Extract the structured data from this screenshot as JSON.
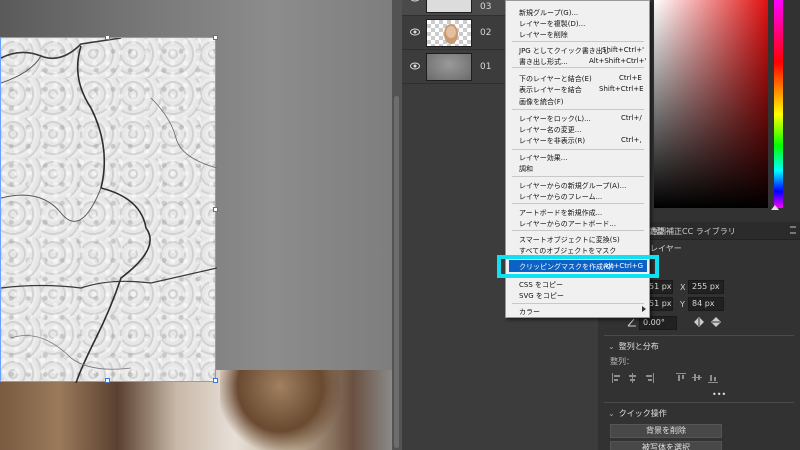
{
  "layers": [
    {
      "number": "03"
    },
    {
      "number": "02"
    },
    {
      "number": "01"
    }
  ],
  "menu": {
    "items": [
      {
        "label": "新規グループ(G)...",
        "shortcut": ""
      },
      {
        "label": "レイヤーを複製(D)...",
        "shortcut": ""
      },
      {
        "label": "レイヤーを削除",
        "shortcut": ""
      },
      {
        "label": "JPG としてクイック書き出し",
        "shortcut": "Shift+Ctrl+'"
      },
      {
        "label": "書き出し形式...",
        "shortcut": "Alt+Shift+Ctrl+'"
      },
      {
        "label": "下のレイヤーと結合(E)",
        "shortcut": "Ctrl+E"
      },
      {
        "label": "表示レイヤーを結合",
        "shortcut": "Shift+Ctrl+E"
      },
      {
        "label": "画像を統合(F)",
        "shortcut": ""
      },
      {
        "label": "レイヤーをロック(L)...",
        "shortcut": "Ctrl+/"
      },
      {
        "label": "レイヤー名の変更...",
        "shortcut": ""
      },
      {
        "label": "レイヤーを非表示(R)",
        "shortcut": "Ctrl+,"
      },
      {
        "label": "レイヤー効果...",
        "shortcut": ""
      },
      {
        "label": "調和",
        "shortcut": ""
      },
      {
        "label": "レイヤーからの新規グループ(A)...",
        "shortcut": ""
      },
      {
        "label": "レイヤーからのフレーム...",
        "shortcut": ""
      },
      {
        "label": "アートボードを新規作成...",
        "shortcut": ""
      },
      {
        "label": "レイヤーからのアートボード...",
        "shortcut": ""
      },
      {
        "label": "スマートオブジェクトに変換(S)",
        "shortcut": ""
      },
      {
        "label": "すべてのオブジェクトをマスク",
        "shortcut": ""
      },
      {
        "label": "クリッピングマスクを作成(Q)",
        "shortcut": "Alt+Ctrl+G"
      },
      {
        "label": "CSS をコピー",
        "shortcut": ""
      },
      {
        "label": "SVG をコピー",
        "shortcut": ""
      },
      {
        "label": "カラー",
        "shortcut": ""
      }
    ]
  },
  "tabs": {
    "adjust": "調整",
    "tone": "色調補正",
    "cc_libraries": "CC ライブラリ"
  },
  "properties": {
    "layer_heading": "レイヤー",
    "w_value": "51 px",
    "h_value": "51 px",
    "x_label": "X",
    "x_value": "255 px",
    "y_label": "Y",
    "y_value": "84 px",
    "angle_value": "0.00°",
    "align_section": "整列と分布",
    "align_label": "整列：",
    "more": "•••",
    "quick_section": "クイック操作",
    "remove_bg_button": "背景を削除",
    "select_subject_button": "被写体を選択"
  },
  "colors": {
    "highlight": "#0a62c6",
    "callout": "#10e0f0",
    "selection": "#6aa0ff"
  }
}
